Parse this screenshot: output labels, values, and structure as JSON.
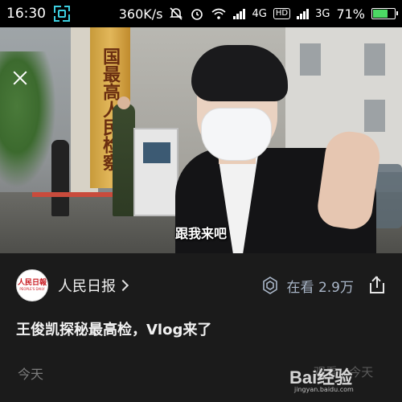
{
  "status_bar": {
    "time": "16:30",
    "speed": "360K/s",
    "network_1": "4G",
    "hd_badge": "HD",
    "network_2": "3G",
    "battery": "71%",
    "battery_level": 0.71
  },
  "video": {
    "plaque_text": "国最高人民检察",
    "subtitle": "跟我来吧"
  },
  "account": {
    "avatar_logo": "人民日報",
    "avatar_sub": "PEOPLE'S DAILY",
    "name": "人民日报",
    "watch_label": "在看 2.9万"
  },
  "post": {
    "title": "王俊凯探秘最高检，Vlog来了",
    "date": "今天",
    "faded_text": "观看 · 今天"
  },
  "watermark": {
    "logo": "Bai经验",
    "url": "jingyan.baidu.com"
  },
  "colors": {
    "accent_blue": "#a9b6c8",
    "battery_green": "#4cd964",
    "logo_red": "#c8161d"
  }
}
